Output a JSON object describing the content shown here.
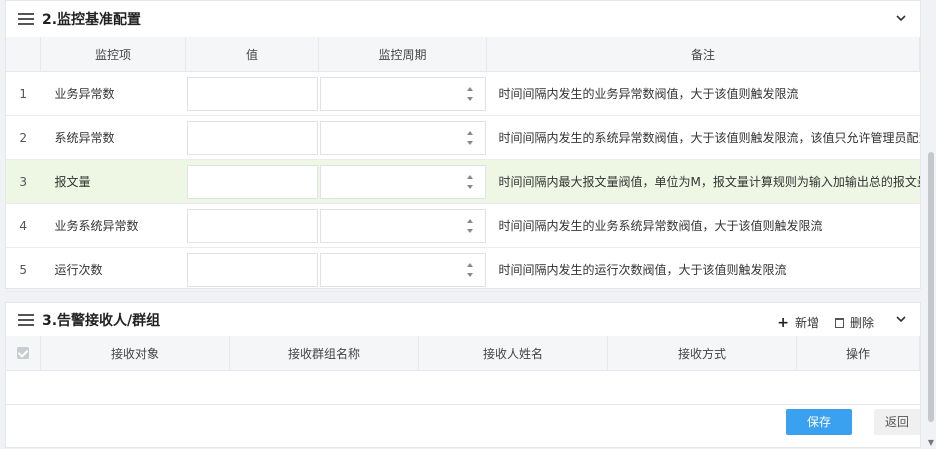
{
  "section2": {
    "title": "2.监控基准配置",
    "columns": {
      "item": "监控项",
      "value": "值",
      "period": "监控周期",
      "note": "备注"
    },
    "rows": [
      {
        "idx": "1",
        "name": "业务异常数",
        "value": "",
        "period": "",
        "note": "时间间隔内发生的业务异常数阀值，大于该值则触发限流"
      },
      {
        "idx": "2",
        "name": "系统异常数",
        "value": "",
        "period": "",
        "note": "时间间隔内发生的系统异常数阀值，大于该值则触发限流，该值只允许管理员配置"
      },
      {
        "idx": "3",
        "name": "报文量",
        "value": "",
        "period": "",
        "note": "时间间隔内最大报文量阀值，单位为M，报文量计算规则为输入加输出总的报文量，大"
      },
      {
        "idx": "4",
        "name": "业务系统异常数",
        "value": "",
        "period": "",
        "note": "时间间隔内发生的业务系统异常数阀值，大于该值则触发限流"
      },
      {
        "idx": "5",
        "name": "运行次数",
        "value": "",
        "period": "",
        "note": "时间间隔内发生的运行次数阀值，大于该值则触发限流"
      }
    ]
  },
  "section3": {
    "title": "3.告警接收人/群组",
    "add_label": "新增",
    "delete_label": "删除",
    "columns": {
      "target": "接收对象",
      "group": "接收群组名称",
      "person": "接收人姓名",
      "method": "接收方式",
      "action": "操作"
    }
  },
  "actions": {
    "save": "保存",
    "back": "返回"
  },
  "colors": {
    "primary": "#3aa0f0",
    "row_highlight": "#eef7e3"
  }
}
